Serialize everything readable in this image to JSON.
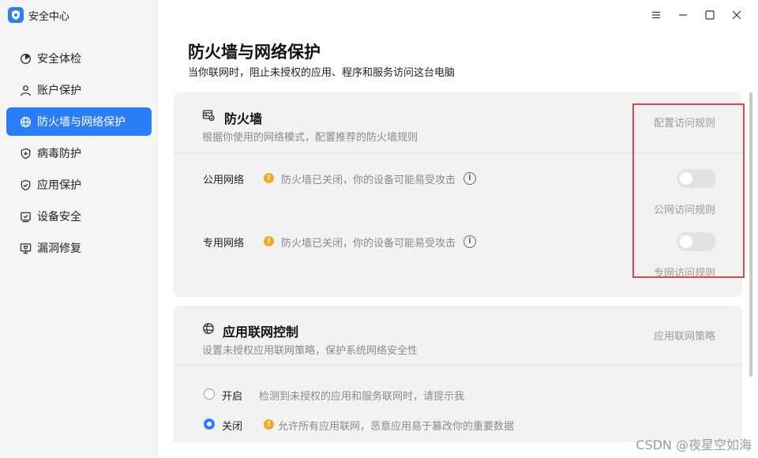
{
  "app": {
    "title": "安全中心",
    "accent": "#2c7ef8"
  },
  "sidebar": {
    "items": [
      {
        "label": "安全体检",
        "icon": "scan-icon"
      },
      {
        "label": "账户保护",
        "icon": "user-icon"
      },
      {
        "label": "防火墙与网络保护",
        "icon": "globe-icon",
        "active": true
      },
      {
        "label": "病毒防护",
        "icon": "shield-plus-icon"
      },
      {
        "label": "应用保护",
        "icon": "shield-check-icon"
      },
      {
        "label": "设备安全",
        "icon": "device-check-icon"
      },
      {
        "label": "漏洞修复",
        "icon": "monitor-bug-icon"
      }
    ]
  },
  "window": {
    "controls": [
      "menu-icon",
      "minimize-icon",
      "maximize-icon",
      "close-icon"
    ]
  },
  "main": {
    "title": "防火墙与网络保护",
    "subtitle": "当你联网时，阻止未授权的应用、程序和服务访问这台电脑"
  },
  "firewall": {
    "title": "防火墙",
    "desc": "根据你使用的网络模式，配置推荐的防火墙规则",
    "config_link": "配置访问规则",
    "rows": [
      {
        "label": "公用网络",
        "warning": "防火墙已关闭，你的设备可能易受攻击",
        "enabled": false,
        "rule_link": "公网访问规则"
      },
      {
        "label": "专用网络",
        "warning": "防火墙已关闭，你的设备可能易受攻击",
        "enabled": false,
        "rule_link": "专网访问规则"
      }
    ]
  },
  "app_control": {
    "title": "应用联网控制",
    "desc": "设置未授权应用联网策略，保护系统网络安全性",
    "policy_link": "应用联网策略",
    "options": [
      {
        "label": "开启",
        "desc": "检测到未授权的应用和服务联网时，请提示我",
        "checked": false
      },
      {
        "label": "关闭",
        "desc": "允许所有应用联网，恶意应用易于篡改你的重要数据",
        "checked": true,
        "warning": true
      }
    ]
  },
  "watermark": "CSDN @夜星空如海"
}
